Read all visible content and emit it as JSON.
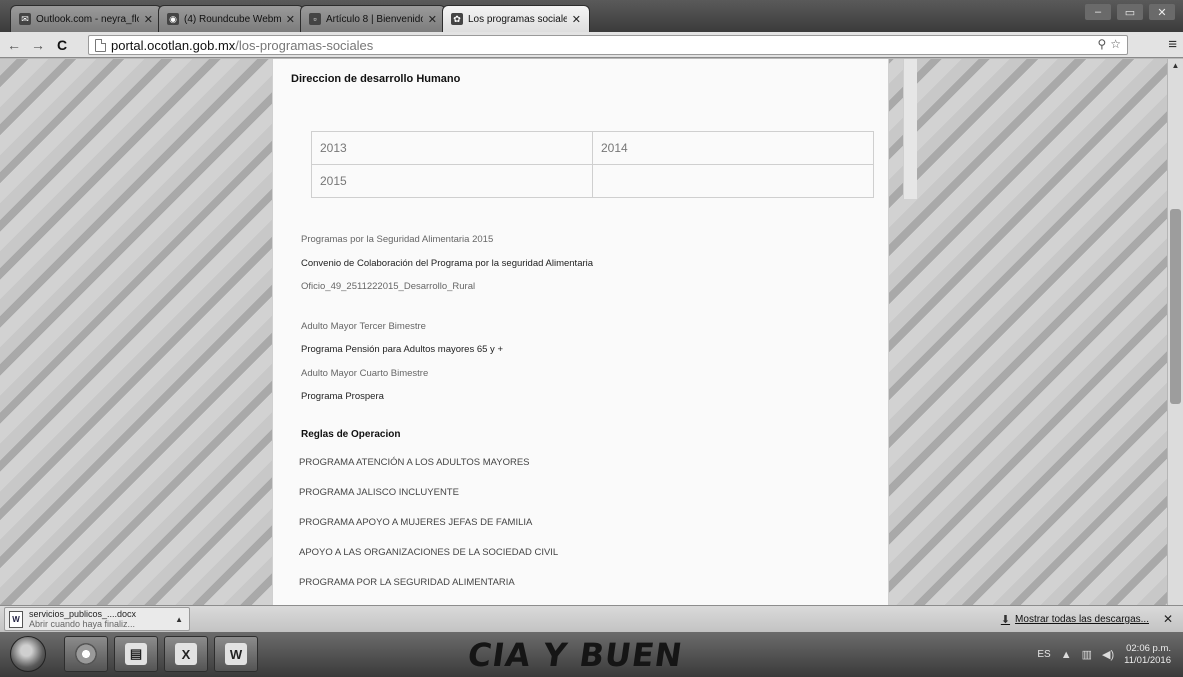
{
  "browser": {
    "tabs": [
      {
        "title": "Outlook.com - neyra_flo...",
        "active": false
      },
      {
        "title": "(4) Roundcube Webmail ::",
        "active": false
      },
      {
        "title": "Artículo 8 | Bienvenido a",
        "active": false
      },
      {
        "title": "Los programas sociales | O",
        "active": true
      }
    ],
    "url_host": "portal.ocotlan.gob.mx",
    "url_path": "/los-programas-sociales"
  },
  "page": {
    "heading": "Direccion de desarrollo Humano",
    "years": [
      "2013",
      "2014",
      "2015",
      ""
    ],
    "links_group_1": [
      {
        "text": "Programas por la Seguridad Alimentaria 2015",
        "strong": false
      },
      {
        "text": "Convenio de Colaboración del Programa por la seguridad Alimentaria",
        "strong": true
      },
      {
        "text": "Oficio_49_2511222015_Desarrollo_Rural",
        "strong": false
      }
    ],
    "links_group_2": [
      {
        "text": "Adulto Mayor Tercer Bimestre",
        "strong": false
      },
      {
        "text": "Programa Pensión para Adultos mayores 65 y +",
        "strong": true
      },
      {
        "text": "Adulto Mayor Cuarto Bimestre",
        "strong": false
      },
      {
        "text": "Programa Prospera",
        "strong": true
      }
    ],
    "reglas_heading": "Reglas de Operacion",
    "reglas": [
      "PROGRAMA ATENCIÓN A LOS ADULTOS MAYORES",
      "PROGRAMA JALISCO INCLUYENTE",
      "PROGRAMA APOYO A MUJERES JEFAS DE FAMILIA",
      "APOYO A LAS ORGANIZACIONES DE LA SOCIEDAD CIVIL",
      "PROGRAMA POR LA SEGURIDAD ALIMENTARIA"
    ]
  },
  "downloads": {
    "item_name": "servicios_publicos_....docx",
    "item_status": "Abrir cuando haya finaliz...",
    "show_all": "Mostrar todas las descargas..."
  },
  "taskbar": {
    "wallpaper_text": "CIA Y BUEN",
    "language": "ES",
    "time": "02:06 p.m.",
    "date": "11/01/2016"
  }
}
